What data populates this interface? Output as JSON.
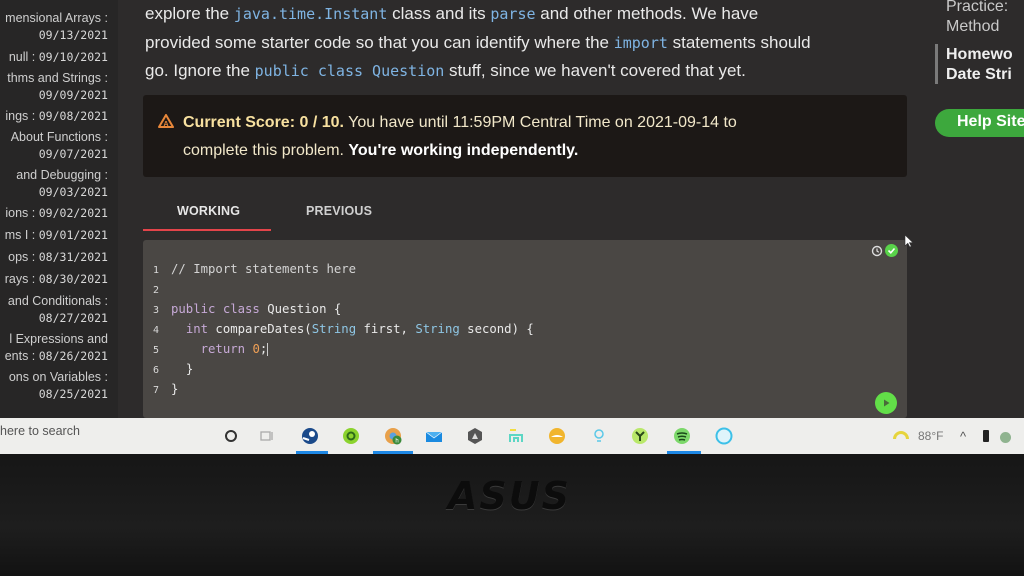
{
  "sidebar": {
    "items": [
      {
        "title": "mensional Arrays :",
        "date": "09/13/2021"
      },
      {
        "title": "null :",
        "date": "09/10/2021"
      },
      {
        "title": "thms and Strings :",
        "date": "09/09/2021"
      },
      {
        "title": "ings :",
        "date": "09/08/2021"
      },
      {
        "title": "About Functions :",
        "date": "09/07/2021"
      },
      {
        "title": "and Debugging :",
        "date": "09/03/2021"
      },
      {
        "title": "ions :",
        "date": "09/02/2021"
      },
      {
        "title": "ms I :",
        "date": "09/01/2021"
      },
      {
        "title": "ops :",
        "date": "08/31/2021"
      },
      {
        "title": "rays :",
        "date": "08/30/2021"
      },
      {
        "title": "and Conditionals :",
        "date": "08/27/2021"
      },
      {
        "title": "l Expressions and",
        "title2": "ents :",
        "date": "08/26/2021"
      },
      {
        "title": "ons on Variables :",
        "date": "08/25/2021"
      }
    ]
  },
  "intro": {
    "line1_a": "explore the ",
    "line1_code1": "java.time.Instant",
    "line1_b": " class and its ",
    "line1_code2": "parse",
    "line1_c": " and other methods. We have",
    "line2_a": "provided some starter code so that you can identify where the ",
    "line2_code": "import",
    "line2_b": " statements should",
    "line3_a": "go. Ignore the ",
    "line3_code": "public class Question",
    "line3_b": " stuff, since we haven't covered that yet."
  },
  "alert": {
    "score_label": "Current Score: 0 / 10.",
    "deadline_text": " You have until 11:59PM Central Time on 2021-09-14 to",
    "line2_text": "complete this problem. ",
    "mode_text": "You're working independently.",
    "warning_color": "#e8873a"
  },
  "tabs": [
    {
      "label": "WORKING",
      "active": true
    },
    {
      "label": "PREVIOUS",
      "active": false
    }
  ],
  "editor": {
    "lines": [
      {
        "n": "1",
        "text": "// Import statements here"
      },
      {
        "n": "2",
        "text": ""
      },
      {
        "n": "3",
        "kw": "public class",
        "rest": " Question {"
      },
      {
        "n": "4",
        "kw": "int",
        "rest1": " compareDates(",
        "t1": "String",
        "rest2": " first, ",
        "t2": "String",
        "rest3": " second) {"
      },
      {
        "n": "5",
        "kw": "return",
        "num": "0",
        "rest": ";"
      },
      {
        "n": "6",
        "text": "}"
      },
      {
        "n": "7",
        "text": "}"
      }
    ],
    "status": "saved"
  },
  "right_sidebar": {
    "practice_line1": "Practice:",
    "practice_line2": "Method",
    "homework_line1": "Homewo",
    "homework_line2": "Date Stri",
    "help_button": "Help Site"
  },
  "taskbar": {
    "search_placeholder": "here to search",
    "apps": [
      "cortana",
      "task-view",
      "steam",
      "app-green-ring",
      "chrome-profile",
      "mail",
      "app-hex",
      "app-cyan",
      "app-yellow-cloud",
      "app-bulb",
      "app-green-y",
      "spotify",
      "app-blue-ring"
    ],
    "temperature": "88°F"
  },
  "bezel": {
    "brand": "ASUS"
  }
}
